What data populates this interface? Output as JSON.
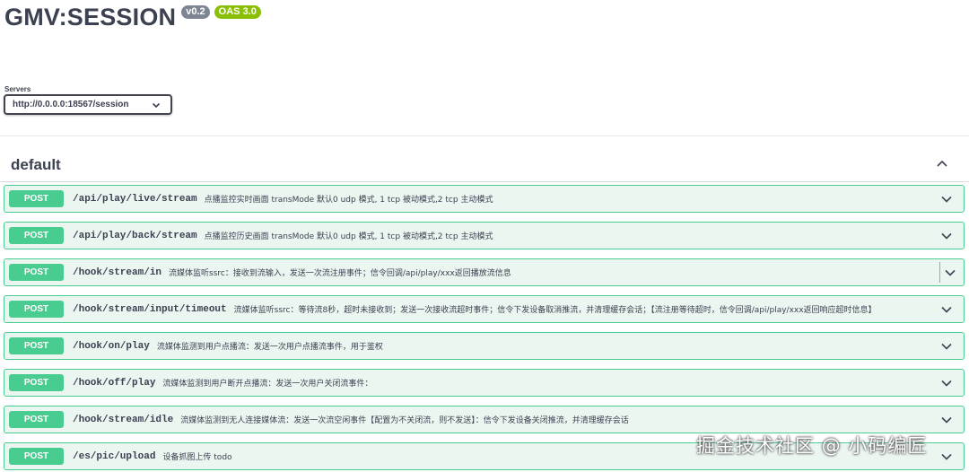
{
  "info": {
    "title": "GMV:SESSION",
    "version_badge": "v0.2",
    "oas_badge": "OAS 3.0"
  },
  "servers": {
    "label": "Servers",
    "selected": "http://0.0.0.0:18567/session"
  },
  "tag": {
    "name": "default"
  },
  "operations": [
    {
      "method": "POST",
      "path": "/api/play/live/stream",
      "summary": "点播监控实时画面 transMode 默认0 udp 模式, 1 tcp 被动模式,2 tcp 主动模式"
    },
    {
      "method": "POST",
      "path": "/api/play/back/stream",
      "summary": "点播监控历史画面 transMode 默认0 udp 模式, 1 tcp 被动模式,2 tcp 主动模式"
    },
    {
      "method": "POST",
      "path": "/hook/stream/in",
      "summary": "流媒体监听ssrc：接收到流输入，发送一次流注册事件；信令回调/api/play/xxx返回播放流信息"
    },
    {
      "method": "POST",
      "path": "/hook/stream/input/timeout",
      "summary": "流媒体监听ssrc：等待流8秒，超时未接收到；发送一次接收流超时事件；信令下发设备取消推流，并清理缓存会话；【流注册等待超时，信令回调/api/play/xxx返回响应超时信息】"
    },
    {
      "method": "POST",
      "path": "/hook/on/play",
      "summary": "流媒体监测到用户点播流：发送一次用户点播流事件，用于鉴权"
    },
    {
      "method": "POST",
      "path": "/hook/off/play",
      "summary": "流媒体监测到用户断开点播流：发送一次用户关闭流事件："
    },
    {
      "method": "POST",
      "path": "/hook/stream/idle",
      "summary": "流媒体监测到无人连接媒体流：发送一次流空闲事件【配置为不关闭流，则不发送】：信令下发设备关闭推流，并清理缓存会话"
    },
    {
      "method": "POST",
      "path": "/es/pic/upload",
      "summary": "设备抓图上传 todo"
    }
  ],
  "watermark": "掘金技术社区 @ 小码编匠",
  "colors": {
    "post": "#49cc90",
    "post_bg": "#ecf6f1",
    "oas": "#89bf04",
    "version": "#7d8492"
  },
  "icons": {
    "expand": "chevron-down-icon",
    "collapse": "chevron-up-icon"
  }
}
